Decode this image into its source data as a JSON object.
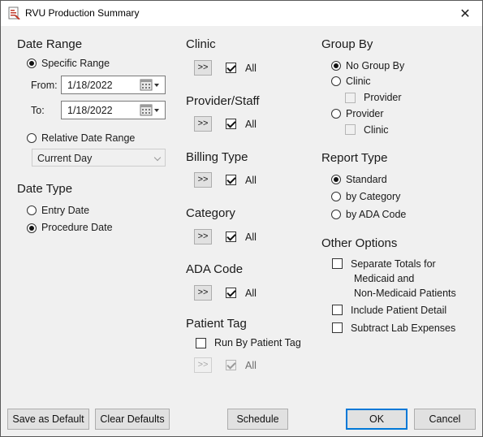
{
  "window": {
    "title": "RVU Production Summary",
    "close_glyph": "✕"
  },
  "date_range": {
    "heading": "Date Range",
    "specific_range_label": "Specific Range",
    "from_label": "From:",
    "from_value": "1/18/2022",
    "to_label": "To:",
    "to_value": "1/18/2022",
    "relative_range_label": "Relative Date Range",
    "relative_range_value": "Current Day",
    "selected": "specific"
  },
  "date_type": {
    "heading": "Date Type",
    "options": [
      "Entry Date",
      "Procedure Date"
    ],
    "selected": "Procedure Date"
  },
  "clinic": {
    "heading": "Clinic",
    "picker_label": ">>",
    "all_label": "All",
    "all_checked": true
  },
  "provider_staff": {
    "heading": "Provider/Staff",
    "picker_label": ">>",
    "all_label": "All",
    "all_checked": true
  },
  "billing_type": {
    "heading": "Billing Type",
    "picker_label": ">>",
    "all_label": "All",
    "all_checked": true
  },
  "category": {
    "heading": "Category",
    "picker_label": ">>",
    "all_label": "All",
    "all_checked": true
  },
  "ada_code": {
    "heading": "ADA Code",
    "picker_label": ">>",
    "all_label": "All",
    "all_checked": true
  },
  "patient_tag": {
    "heading": "Patient Tag",
    "run_by_label": "Run By Patient Tag",
    "run_by_checked": false,
    "picker_label": ">>",
    "all_label": "All",
    "all_checked": true,
    "enabled": false
  },
  "group_by": {
    "heading": "Group By",
    "no_group_label": "No Group By",
    "clinic_label": "Clinic",
    "clinic_sub_label": "Provider",
    "provider_label": "Provider",
    "provider_sub_label": "Clinic",
    "selected": "No Group By"
  },
  "report_type": {
    "heading": "Report Type",
    "options": [
      "Standard",
      "by Category",
      "by ADA Code"
    ],
    "selected": "Standard"
  },
  "other_options": {
    "heading": "Other Options",
    "separate_totals_line1": "Separate Totals for",
    "separate_totals_line2": "Medicaid and",
    "separate_totals_line3": "Non-Medicaid Patients",
    "include_detail_label": "Include Patient Detail",
    "subtract_lab_label": "Subtract Lab Expenses"
  },
  "buttons": {
    "save_default": "Save as Default",
    "clear_defaults": "Clear Defaults",
    "schedule": "Schedule",
    "ok": "OK",
    "cancel": "Cancel"
  },
  "icons": {
    "app": "report-icon",
    "calendar": "calendar-icon",
    "close": "close-icon"
  },
  "colors": {
    "background": "#f0f0f0",
    "primary_border": "#0078d7"
  }
}
